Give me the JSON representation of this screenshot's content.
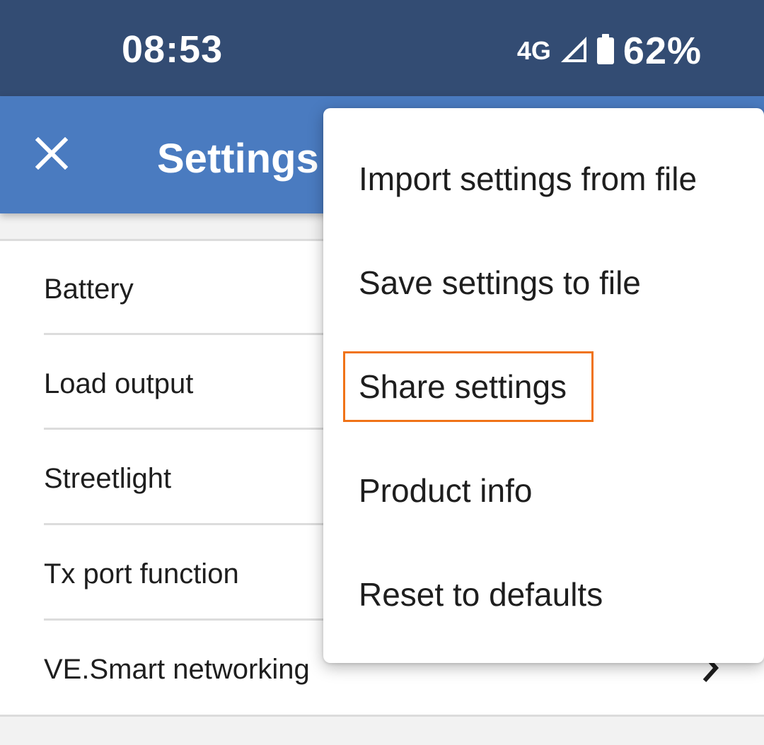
{
  "status_bar": {
    "time": "08:53",
    "network": "4G",
    "battery_percent": "62%",
    "icons": [
      "signal-icon",
      "battery-icon"
    ]
  },
  "app_bar": {
    "title": "Settings",
    "close_icon": "close-icon"
  },
  "settings_list": {
    "items": [
      {
        "label": "Battery"
      },
      {
        "label": "Load output"
      },
      {
        "label": "Streetlight"
      },
      {
        "label": "Tx port function"
      },
      {
        "label": "VE.Smart networking",
        "icon": "chevron-right-icon"
      }
    ]
  },
  "overflow_menu": {
    "items": [
      {
        "label": "Import settings from file"
      },
      {
        "label": "Save settings to file"
      },
      {
        "label": "Share settings",
        "highlighted": true
      },
      {
        "label": "Product info"
      },
      {
        "label": "Reset to defaults"
      }
    ]
  },
  "colors": {
    "status_bar": "#334c73",
    "app_bar": "#4a7bc0",
    "highlight": "#f07318"
  }
}
